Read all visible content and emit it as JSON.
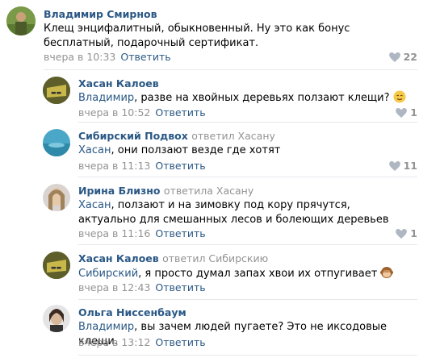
{
  "comments": [
    {
      "author": "Владимир Смирнов",
      "reply_to": "",
      "mention": "",
      "text": "Клещ энцифалитный, обыкновенный. Ну это как бонус бесплатный, подарочный сертификат.",
      "time": "вчера в 10:33",
      "reply_label": "Ответить",
      "likes": "22"
    },
    {
      "author": "Хасан Калоев",
      "reply_to": "",
      "mention": "Владимир",
      "text": ", разве на хвойных деревьях ползают клещи?",
      "time": "вчера в 10:52",
      "reply_label": "Ответить",
      "likes": "1"
    },
    {
      "author": "Сибирский Подвох",
      "reply_to": "ответил Хасану",
      "mention": "Хасан",
      "text": ", они ползают везде где хотят",
      "time": "вчера в 11:13",
      "reply_label": "Ответить",
      "likes": "11"
    },
    {
      "author": "Ирина Близно",
      "reply_to": "ответила Хасану",
      "mention": "Хасан",
      "text": ", ползают и на зимовку под кору прячутся, актуально для смешанных лесов и болеющих деревьев",
      "time": "вчера в 11:16",
      "reply_label": "Ответить",
      "likes": "1"
    },
    {
      "author": "Хасан Калоев",
      "reply_to": "ответил Сибирскию",
      "mention": "Сибирский",
      "text": ", я просто думал запах хвои их отпугивает",
      "time": "вчера в 12:43",
      "reply_label": "Ответить",
      "likes": ""
    },
    {
      "author": "Ольга Ниссенбаум",
      "reply_to": "",
      "mention": "Владимир",
      "text": ", вы зачем людей пугаете? Это не иксодовые клещи.",
      "time": "вчера в 13:12",
      "reply_label": "Ответить",
      "likes": ""
    }
  ],
  "colors": {
    "link": "#2a5885",
    "meta": "#939393",
    "divider": "#e7e8ec"
  },
  "icons": [
    "heart-icon",
    "emoji-smile-icon",
    "emoji-monkey-icon"
  ]
}
